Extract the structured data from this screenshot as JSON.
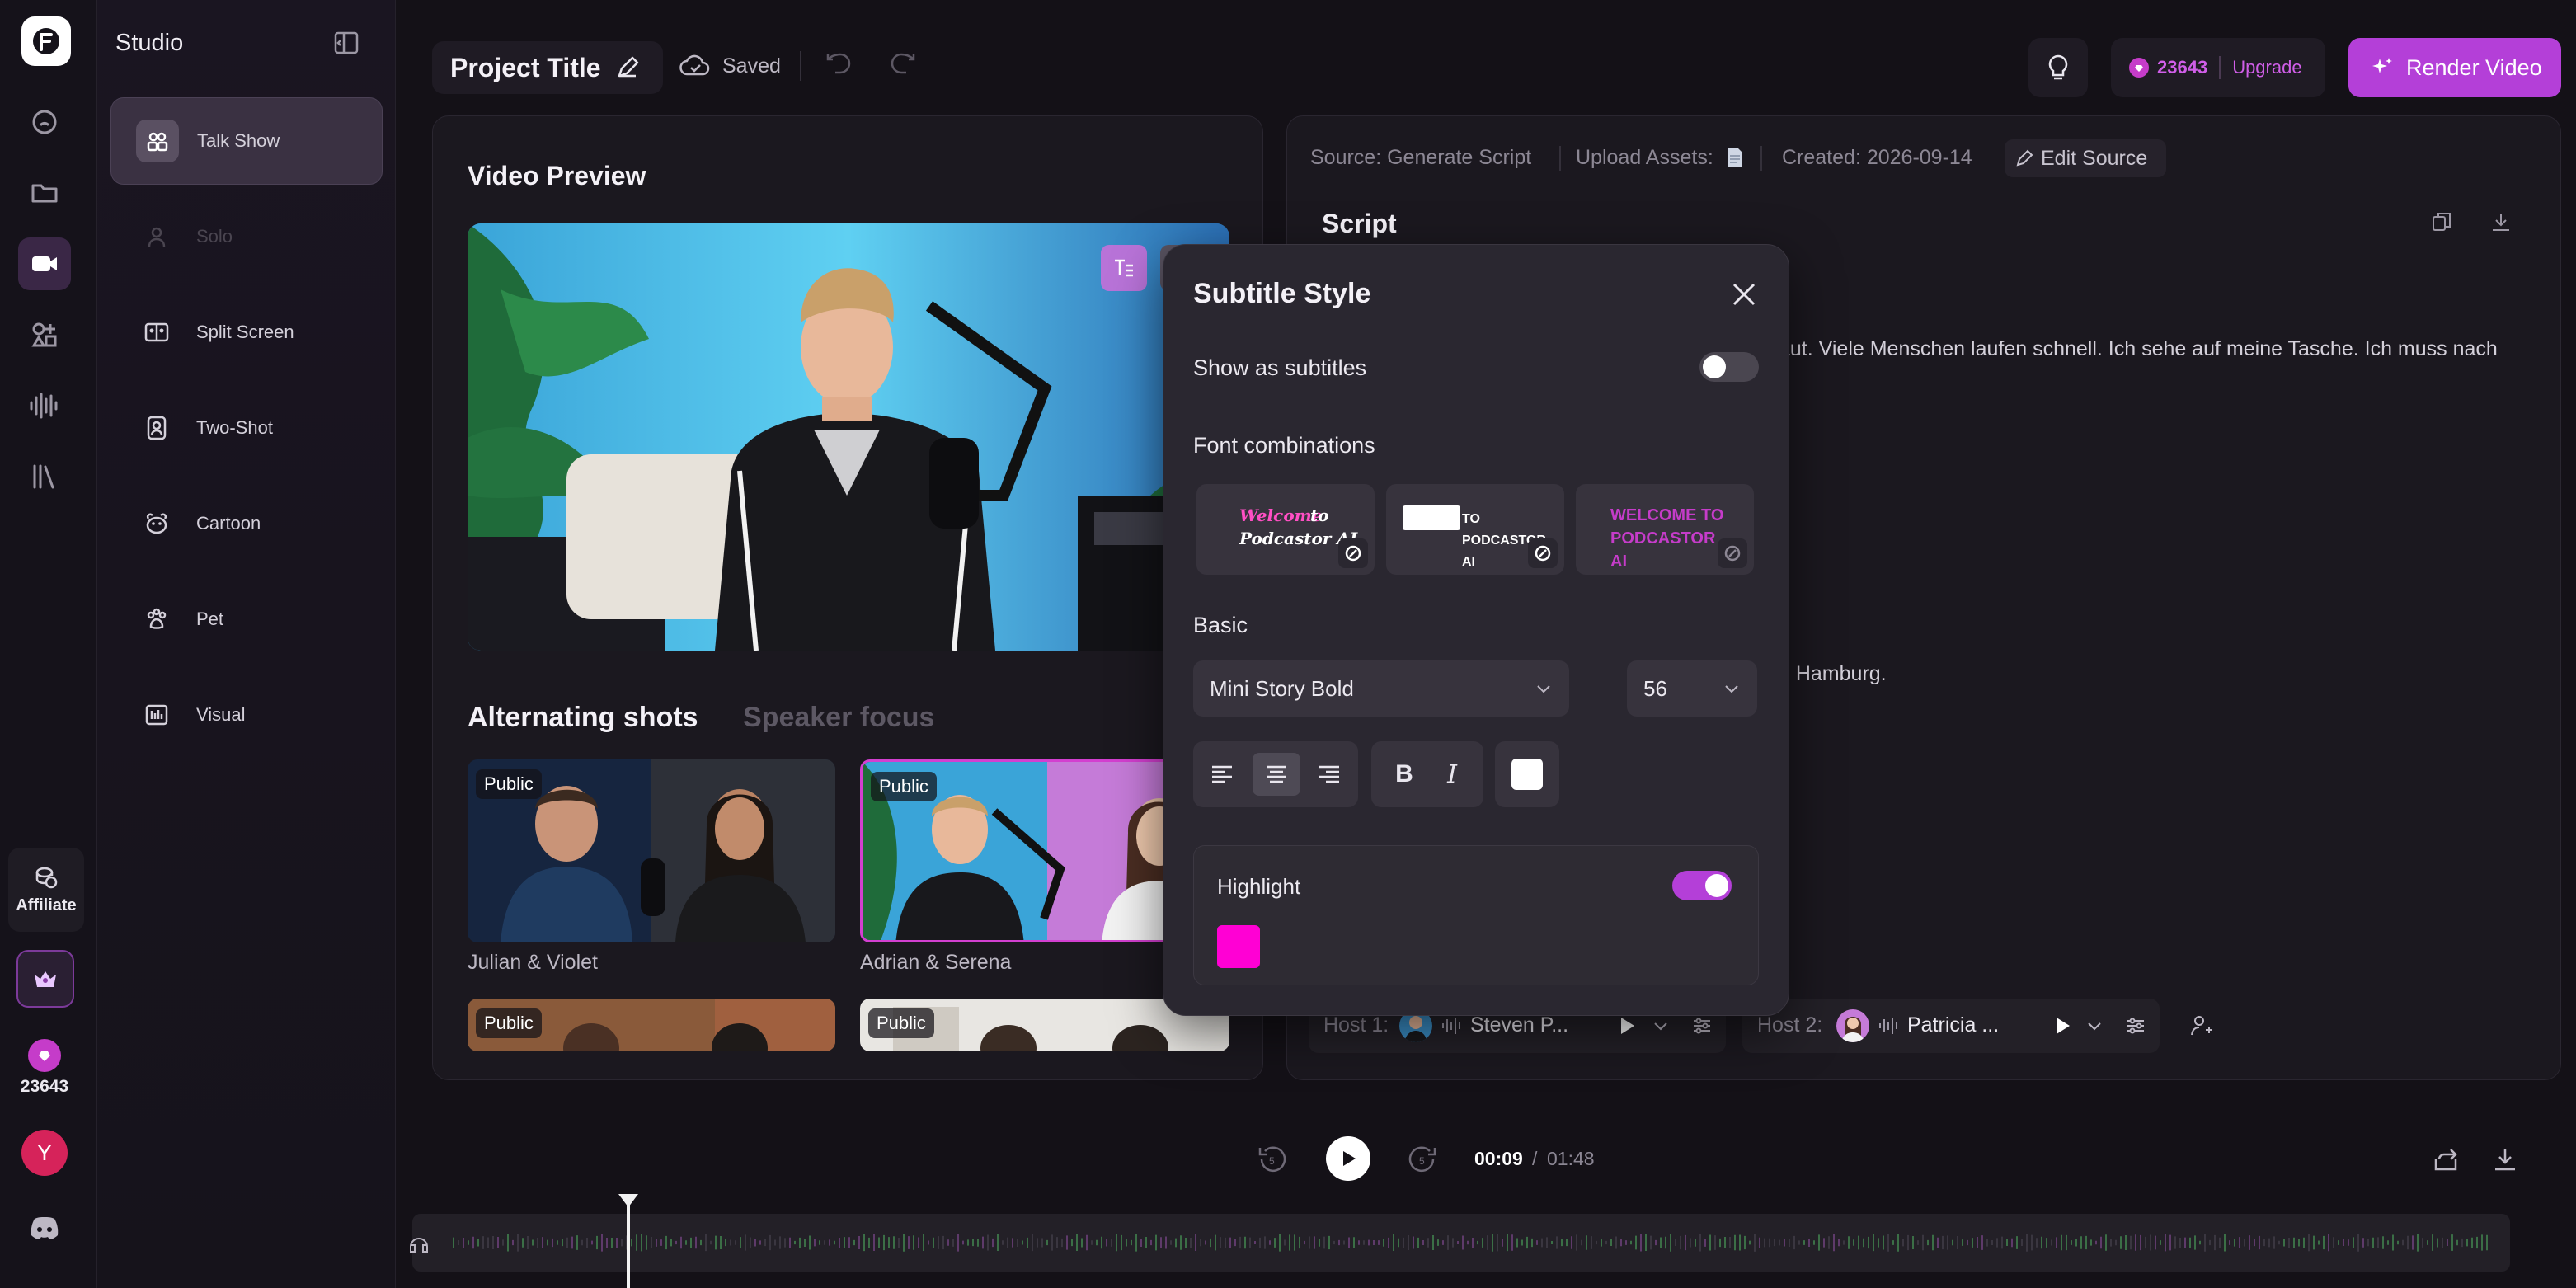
{
  "rail": {
    "items": [
      {
        "name": "home",
        "icon": "home-icon"
      },
      {
        "name": "projects",
        "icon": "folder-icon"
      },
      {
        "name": "video",
        "icon": "video-camera-icon"
      },
      {
        "name": "shapes",
        "icon": "shapes-icon"
      },
      {
        "name": "audio",
        "icon": "waveform-icon"
      },
      {
        "name": "library",
        "icon": "library-icon"
      }
    ],
    "affiliate_label": "Affiliate",
    "credits": "23643",
    "avatar_initial": "Y"
  },
  "studio": {
    "title": "Studio",
    "items": [
      {
        "label": "Talk Show",
        "active": true
      },
      {
        "label": "Solo",
        "disabled": true
      },
      {
        "label": "Split Screen"
      },
      {
        "label": "Two-Shot"
      },
      {
        "label": "Cartoon"
      },
      {
        "label": "Pet"
      },
      {
        "label": "Visual"
      }
    ]
  },
  "topbar": {
    "project_title": "Project Title",
    "saved_label": "Saved",
    "credits": "23643",
    "upgrade_label": "Upgrade",
    "render_label": "Render Video"
  },
  "preview": {
    "title": "Video Preview",
    "tabs": [
      "Alternating shots",
      "Speaker focus"
    ],
    "thumbs": [
      {
        "badge": "Public",
        "caption": "Julian & Violet"
      },
      {
        "badge": "Public",
        "caption": "Adrian & Serena"
      },
      {
        "badge": "Public",
        "caption": ""
      },
      {
        "badge": "Public",
        "caption": ""
      }
    ]
  },
  "script": {
    "source": "Source: Generate Script",
    "upload_assets": "Upload Assets:",
    "created": "Created: 2026-09-14",
    "edit_source": "Edit Source",
    "title": "Script",
    "line1": "aut. Viele Menschen laufen schnell. Ich sehe auf meine Tasche. Ich muss nach",
    "line2": "h Hamburg.",
    "host1_label": "Host 1:",
    "host1_name": "Steven P...",
    "host2_label": "Host 2:",
    "host2_name": "Patricia ..."
  },
  "modal": {
    "title": "Subtitle Style",
    "show_subtitles_label": "Show as subtitles",
    "show_subtitles_on": false,
    "font_combos_label": "Font combinations",
    "combo1_a": "Welcome",
    "combo1_b": "to",
    "combo1_c": "Podcastor AI",
    "combo2": "TO PODCASTOR AI",
    "combo3": "WELCOME TO PODCASTOR AI",
    "basic_label": "Basic",
    "font_family": "Mini Story Bold",
    "font_size": "56",
    "highlight_label": "Highlight",
    "highlight_on": true,
    "highlight_color": "#ff00d4"
  },
  "player": {
    "current_time": "00:09",
    "separator": "/",
    "total_time": "01:48"
  },
  "colors": {
    "accent": "#b43fd8",
    "accent_light": "#c45be6"
  }
}
